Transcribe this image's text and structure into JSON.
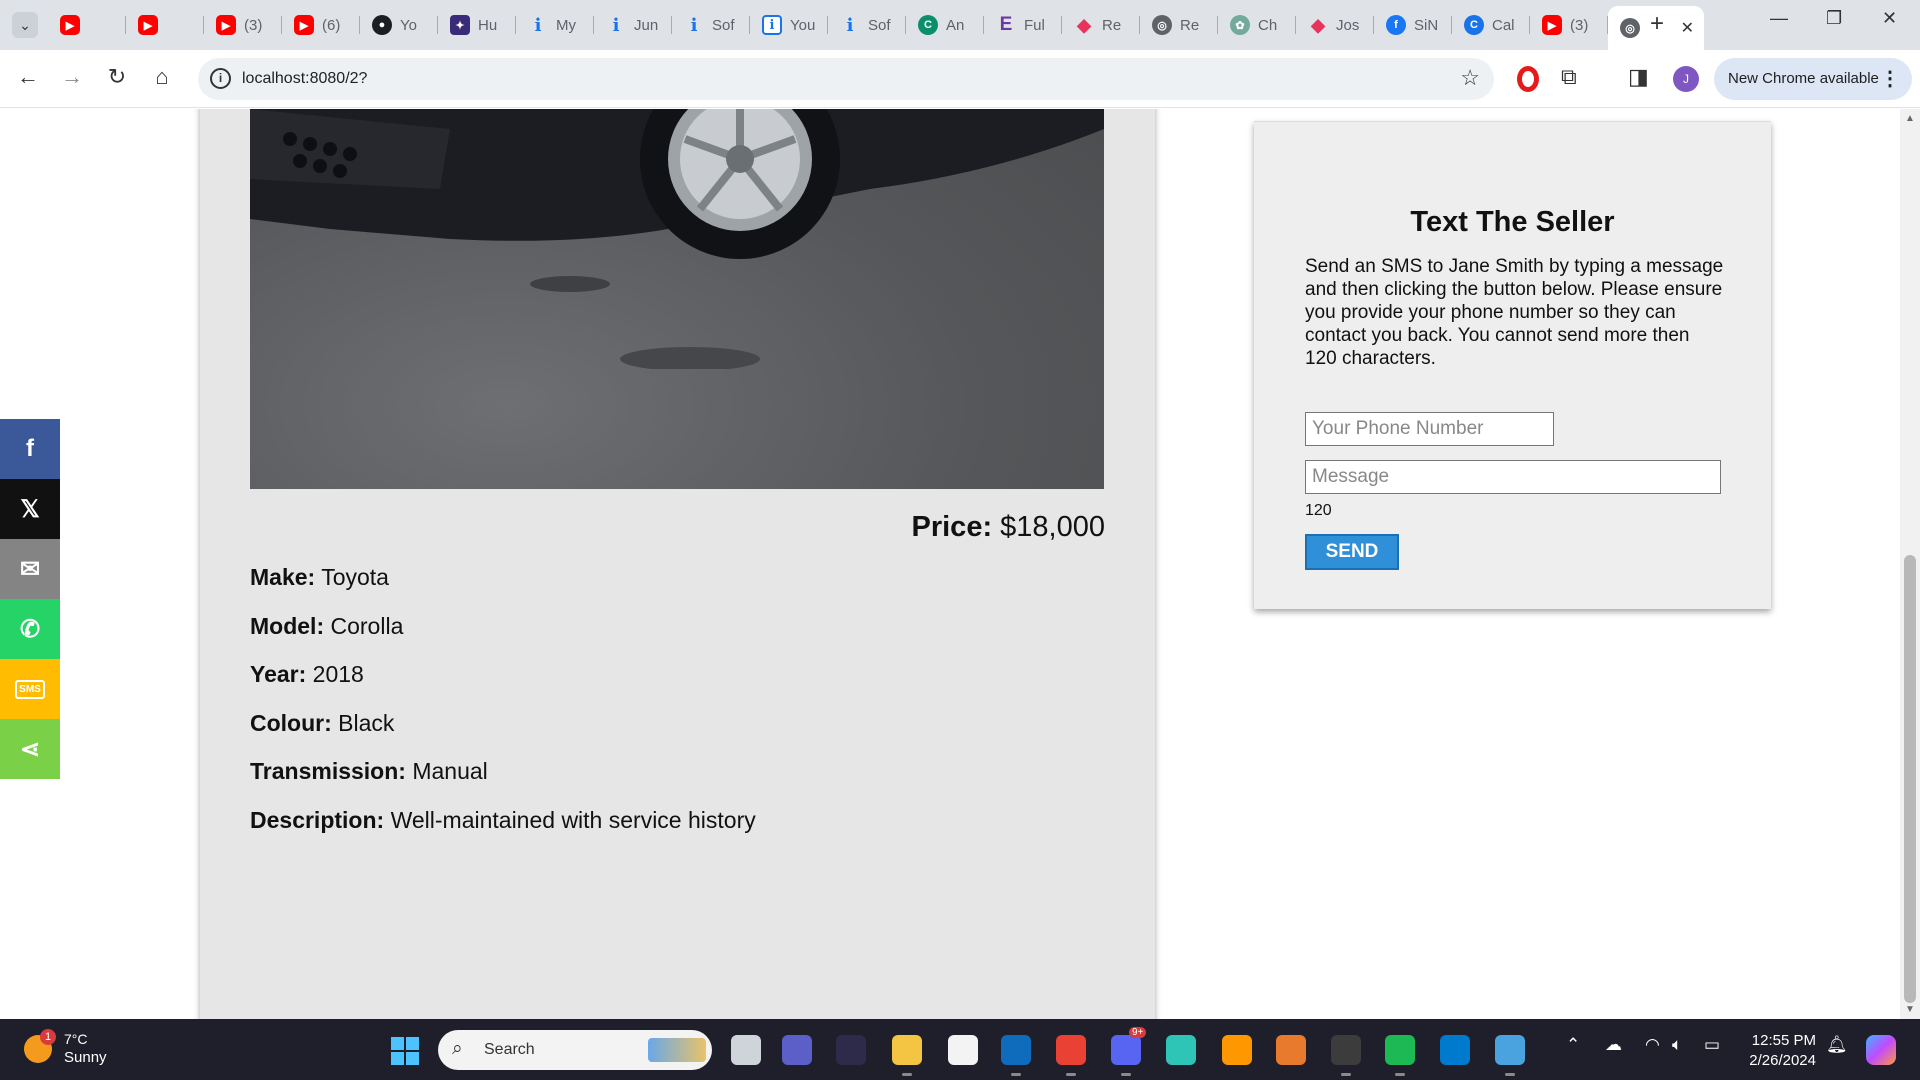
{
  "browser": {
    "tabs": [
      {
        "label": "",
        "icon": "youtube-icon",
        "fav": "yt",
        "glyph": "▶"
      },
      {
        "label": "",
        "icon": "youtube-icon",
        "fav": "yt",
        "glyph": "▶"
      },
      {
        "label": "(3)",
        "icon": "youtube-icon",
        "fav": "yt",
        "glyph": "▶"
      },
      {
        "label": "(6)",
        "icon": "youtube-icon",
        "fav": "yt",
        "glyph": "▶"
      },
      {
        "label": "Yo",
        "icon": "github-icon",
        "fav": "gh",
        "glyph": "●"
      },
      {
        "label": "Hu",
        "icon": "hu-app-icon",
        "fav": "hu",
        "glyph": "✦"
      },
      {
        "label": "My",
        "icon": "info-icon",
        "fav": "info",
        "glyph": "i"
      },
      {
        "label": "Jun",
        "icon": "info-icon",
        "fav": "info",
        "glyph": "i"
      },
      {
        "label": "Sof",
        "icon": "info-icon",
        "fav": "info",
        "glyph": "i"
      },
      {
        "label": "You",
        "icon": "info-box-icon",
        "fav": "infobox",
        "glyph": "i"
      },
      {
        "label": "Sof",
        "icon": "info-icon",
        "fav": "info",
        "glyph": "i"
      },
      {
        "label": "An",
        "icon": "an-app-icon",
        "fav": "an",
        "glyph": "C"
      },
      {
        "label": "Ful",
        "icon": "e-logo-icon",
        "fav": "e",
        "glyph": "E"
      },
      {
        "label": "Re",
        "icon": "re-logo-icon",
        "fav": "re",
        "glyph": "◆"
      },
      {
        "label": "Re",
        "icon": "globe-icon",
        "fav": "globe",
        "glyph": "◎"
      },
      {
        "label": "Ch",
        "icon": "chatgpt-icon",
        "fav": "ch",
        "glyph": "✿"
      },
      {
        "label": "Jos",
        "icon": "re-logo-icon",
        "fav": "re",
        "glyph": "◆"
      },
      {
        "label": "SiN",
        "icon": "facebook-icon",
        "fav": "fb",
        "glyph": "f"
      },
      {
        "label": "Cal",
        "icon": "ca-app-icon",
        "fav": "ca",
        "glyph": "C"
      },
      {
        "label": "(3)",
        "icon": "youtube-icon",
        "fav": "yt",
        "glyph": "▶"
      }
    ],
    "active_tab_icon": "globe-icon",
    "url": "localhost:8080/2?",
    "update_button": "New Chrome available"
  },
  "listing": {
    "price_label": "Price:",
    "price_value": "$18,000",
    "specs": [
      {
        "key": "Make:",
        "value": "Toyota"
      },
      {
        "key": "Model:",
        "value": "Corolla"
      },
      {
        "key": "Year:",
        "value": "2018"
      },
      {
        "key": "Colour:",
        "value": "Black"
      },
      {
        "key": "Transmission:",
        "value": "Manual"
      },
      {
        "key": "Description:",
        "value": "Well-maintained with service history"
      }
    ]
  },
  "seller_form": {
    "title": "Text The Seller",
    "instructions": "Send an SMS to Jane Smith by typing a message and then clicking the button below. Please ensure you provide your phone number so they can contact you back. You cannot send more then 120 characters.",
    "phone_placeholder": "Your Phone Number",
    "message_placeholder": "Message",
    "char_count": "120",
    "send_label": "SEND"
  },
  "share_bar": [
    {
      "name": "share-facebook-button",
      "icon": "facebook-icon",
      "glyph": "f",
      "cls": "s-fb"
    },
    {
      "name": "share-x-button",
      "icon": "x-logo-icon",
      "glyph": "𝕏",
      "cls": "s-x"
    },
    {
      "name": "share-email-button",
      "icon": "mail-icon",
      "glyph": "✉",
      "cls": "s-mail"
    },
    {
      "name": "share-whatsapp-button",
      "icon": "whatsapp-icon",
      "glyph": "✆",
      "cls": "s-wa"
    },
    {
      "name": "share-sms-button",
      "icon": "sms-icon",
      "glyph": "SMS",
      "cls": "s-sms"
    },
    {
      "name": "share-more-button",
      "icon": "share-icon",
      "glyph": "⋖",
      "cls": "s-share"
    }
  ],
  "taskbar": {
    "weather_badge": "1",
    "temperature": "7°C",
    "condition": "Sunny",
    "search_label": "Search",
    "apps": [
      {
        "name": "task-view-icon",
        "color": "#cfd4da",
        "running": false
      },
      {
        "name": "zoom-icon",
        "color": "#5b5fc7",
        "running": false
      },
      {
        "name": "game-app-icon",
        "color": "#2d2a4a",
        "running": false
      },
      {
        "name": "file-explorer-icon",
        "color": "#f4c542",
        "running": true
      },
      {
        "name": "microsoft-store-icon",
        "color": "#f3f3f3",
        "running": false
      },
      {
        "name": "outlook-icon",
        "color": "#0f6cbd",
        "running": true
      },
      {
        "name": "chrome-icon",
        "color": "#e94235",
        "running": true
      },
      {
        "name": "discord-icon",
        "color": "#5865f2",
        "running": true
      },
      {
        "name": "edge-icon",
        "color": "#2ec4b6",
        "running": false
      },
      {
        "name": "sublime-icon",
        "color": "#ff9800",
        "running": false
      },
      {
        "name": "postman-icon",
        "color": "#e87a2d",
        "running": false
      },
      {
        "name": "terminal-icon",
        "color": "#3c3c3c",
        "running": true
      },
      {
        "name": "spotify-icon",
        "color": "#1db954",
        "running": true
      },
      {
        "name": "vscode-icon",
        "color": "#007acc",
        "running": false
      },
      {
        "name": "notepad-icon",
        "color": "#4aa3df",
        "running": true
      }
    ],
    "discord_badge": "9+",
    "time": "12:55 PM",
    "date": "2/26/2024"
  }
}
